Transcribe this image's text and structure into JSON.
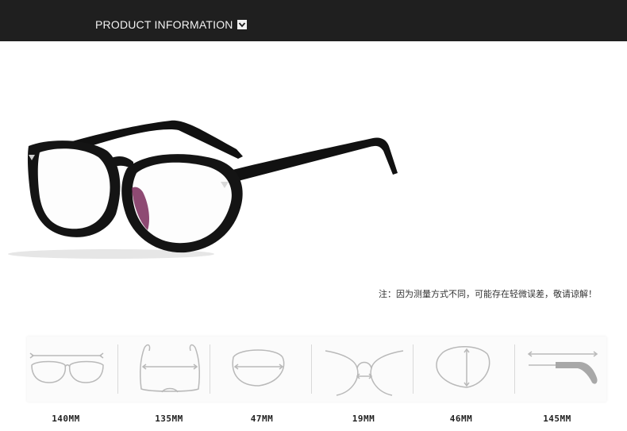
{
  "header": {
    "title": "PRODUCT INFORMATION",
    "chevron_icon": "chevron-down-icon"
  },
  "note": "注：因为测量方式不同，可能存在轻微误差，敬请谅解！",
  "measurements": [
    {
      "icon": "frame-width-icon",
      "value": "140MM"
    },
    {
      "icon": "temple-spread-icon",
      "value": "135MM"
    },
    {
      "icon": "lens-width-icon",
      "value": "47MM"
    },
    {
      "icon": "bridge-width-icon",
      "value": "19MM"
    },
    {
      "icon": "lens-height-icon",
      "value": "46MM"
    },
    {
      "icon": "temple-length-icon",
      "value": "145MM"
    }
  ],
  "colors": {
    "header_bg": "#1f1f1f",
    "frame": "#111111",
    "diagram_stroke": "#b9b9b9"
  }
}
